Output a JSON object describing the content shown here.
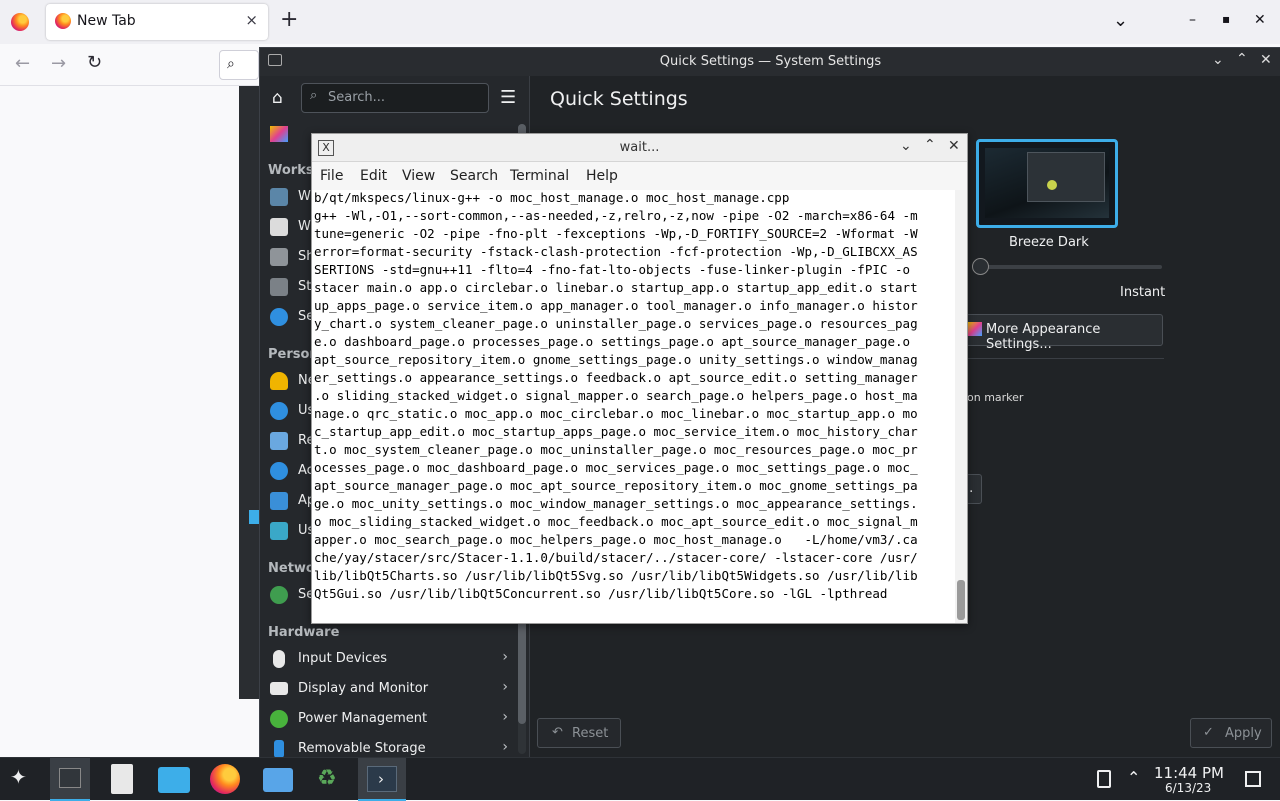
{
  "firefox": {
    "tab_title": "New Tab",
    "tab_close": "×",
    "new_tab": "+",
    "list_tabs": "⌄",
    "back": "←",
    "forward": "→",
    "reload": "↻",
    "minimize": "–",
    "maximize": "▪",
    "close": "✕"
  },
  "settings": {
    "window_title": "Quick Settings — System Settings",
    "search_placeholder": "Search...",
    "page_title": "Quick Settings",
    "sections": {
      "workspace": "Works",
      "personalization": "Person",
      "network": "Netwo",
      "hardware": "Hardware"
    },
    "partial_items": {
      "w1": "W",
      "w2": "W",
      "sh": "Sh",
      "st": "St",
      "se": "Se",
      "ne": "Ne",
      "us": "Us",
      "re": "Re",
      "ac": "Ac",
      "ap": "Ap",
      "us2": "Us",
      "se2": "Se"
    },
    "hardware_items": [
      {
        "label": "Input Devices"
      },
      {
        "label": "Display and Monitor"
      },
      {
        "label": "Power Management"
      },
      {
        "label": "Removable Storage"
      }
    ],
    "theme_name": "Breeze Dark",
    "animation_speed_label": "Instant",
    "more_appearance_button": "More Appearance Settings...",
    "marker_text": "on marker",
    "partial_button": "..",
    "reset_button": "Reset",
    "apply_button": "Apply"
  },
  "terminal": {
    "title": "wait...",
    "menu": [
      "File",
      "Edit",
      "View",
      "Search",
      "Terminal",
      "Help"
    ],
    "lines": [
      "b/qt/mkspecs/linux-g++ -o moc_host_manage.o moc_host_manage.cpp",
      "g++ -Wl,-O1,--sort-common,--as-needed,-z,relro,-z,now -pipe -O2 -march=x86-64 -m",
      "tune=generic -O2 -pipe -fno-plt -fexceptions -Wp,-D_FORTIFY_SOURCE=2 -Wformat -W",
      "error=format-security -fstack-clash-protection -fcf-protection -Wp,-D_GLIBCXX_AS",
      "SERTIONS -std=gnu++11 -flto=4 -fno-fat-lto-objects -fuse-linker-plugin -fPIC -o",
      "stacer main.o app.o circlebar.o linebar.o startup_app.o startup_app_edit.o start",
      "up_apps_page.o service_item.o app_manager.o tool_manager.o info_manager.o histor",
      "y_chart.o system_cleaner_page.o uninstaller_page.o services_page.o resources_pag",
      "e.o dashboard_page.o processes_page.o settings_page.o apt_source_manager_page.o",
      "apt_source_repository_item.o gnome_settings_page.o unity_settings.o window_manag",
      "er_settings.o appearance_settings.o feedback.o apt_source_edit.o setting_manager",
      ".o sliding_stacked_widget.o signal_mapper.o search_page.o helpers_page.o host_ma",
      "nage.o qrc_static.o moc_app.o moc_circlebar.o moc_linebar.o moc_startup_app.o mo",
      "c_startup_app_edit.o moc_startup_apps_page.o moc_service_item.o moc_history_char",
      "t.o moc_system_cleaner_page.o moc_uninstaller_page.o moc_resources_page.o moc_pr",
      "ocesses_page.o moc_dashboard_page.o moc_services_page.o moc_settings_page.o moc_",
      "apt_source_manager_page.o moc_apt_source_repository_item.o moc_gnome_settings_pa",
      "ge.o moc_unity_settings.o moc_window_manager_settings.o moc_appearance_settings.",
      "o moc_sliding_stacked_widget.o moc_feedback.o moc_apt_source_edit.o moc_signal_m",
      "apper.o moc_search_page.o moc_helpers_page.o moc_host_manage.o   -L/home/vm3/.ca",
      "che/yay/stacer/src/Stacer-1.1.0/build/stacer/../stacer-core/ -lstacer-core /usr/",
      "lib/libQt5Charts.so /usr/lib/libQt5Svg.so /usr/lib/libQt5Widgets.so /usr/lib/lib",
      "Qt5Gui.so /usr/lib/libQt5Concurrent.so /usr/lib/libQt5Core.so -lGL -lpthread"
    ]
  },
  "taskbar": {
    "time": "11:44 PM",
    "date": "6/13/23"
  }
}
